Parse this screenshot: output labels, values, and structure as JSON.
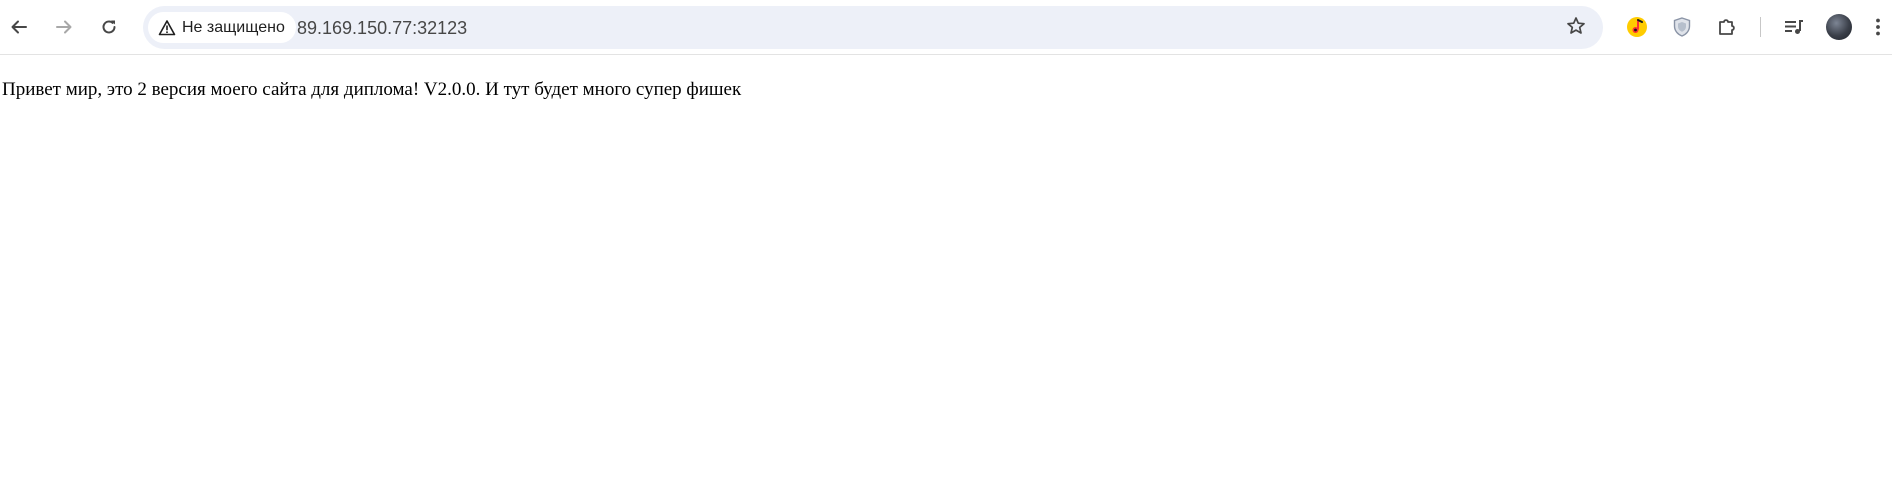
{
  "browser": {
    "security_label": "Не защищено",
    "url": "89.169.150.77:32123",
    "icons": {
      "back": "back-arrow-icon",
      "forward": "forward-arrow-icon",
      "reload": "reload-icon",
      "security": "warning-triangle-icon",
      "bookmark": "star-icon",
      "music_extension": "yandex-music-icon",
      "shield_extension": "shield-icon",
      "extensions": "puzzle-icon",
      "media_controls": "playlist-music-icon",
      "profile": "avatar",
      "menu": "kebab-menu-icon"
    },
    "colors": {
      "omnibox_bg": "#edf0f8",
      "toolbar_bg": "#ffffff",
      "icon": "#474747"
    }
  },
  "page": {
    "text": "Привет мир, это 2 версия моего сайта для диплома! V2.0.0. И тут будет много супер фишек"
  }
}
